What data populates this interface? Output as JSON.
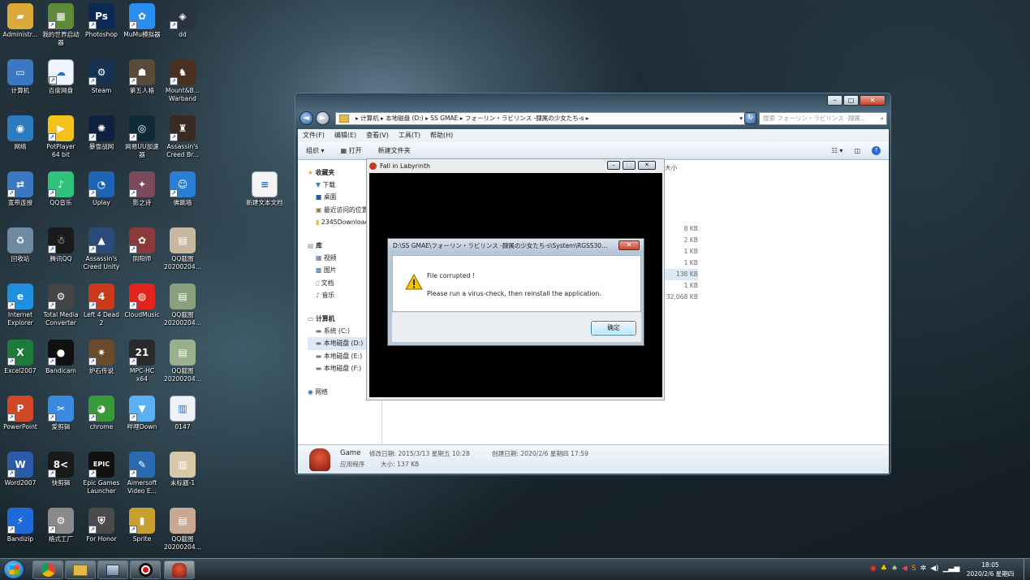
{
  "desktop": {
    "icons": [
      {
        "label": "Administr...",
        "icon": "folder-icon",
        "color": "#d9a93a",
        "glyph": "▰"
      },
      {
        "label": "我的世界启动器",
        "icon": "minecraft-icon",
        "color": "#5d8a3a",
        "glyph": "▦"
      },
      {
        "label": "Photoshop",
        "icon": "photoshop-icon",
        "color": "#0a2a55",
        "glyph": "Ps"
      },
      {
        "label": "MuMu模拟器",
        "icon": "mumu-icon",
        "color": "#2a8df0",
        "glyph": "✿"
      },
      {
        "label": "dd",
        "icon": "dd-icon",
        "color": "#2a3440",
        "glyph": "◈"
      },
      {
        "label": "计算机",
        "icon": "computer-icon",
        "color": "#3a78c2",
        "glyph": "▭"
      },
      {
        "label": "百度网盘",
        "icon": "baidu-netdisk-icon",
        "color": "#eef5ff",
        "glyph": "☁"
      },
      {
        "label": "Steam",
        "icon": "steam-icon",
        "color": "#16324f",
        "glyph": "⚙"
      },
      {
        "label": "第五人格",
        "icon": "identity-v-icon",
        "color": "#5a4a3a",
        "glyph": "☗"
      },
      {
        "label": "Mount&B... Warband",
        "icon": "mount-blade-icon",
        "color": "#4a3020",
        "glyph": "♞"
      },
      {
        "label": "网络",
        "icon": "network-icon",
        "color": "#2b7bbf",
        "glyph": "◉"
      },
      {
        "label": "PotPlayer 64 bit",
        "icon": "potplayer-icon",
        "color": "#f3c21a",
        "glyph": "▶"
      },
      {
        "label": "暴雪战网",
        "icon": "battlenet-icon",
        "color": "#0e2140",
        "glyph": "✺"
      },
      {
        "label": "网易UU加速器",
        "icon": "uu-accelerator-icon",
        "color": "#0f2b3a",
        "glyph": "◎"
      },
      {
        "label": "Assassin's Creed Br...",
        "icon": "assassins-creed-brotherhood-icon",
        "color": "#3a2a24",
        "glyph": "♜"
      },
      {
        "label": "宽带连接",
        "icon": "broadband-icon",
        "color": "#3a78c2",
        "glyph": "⇄"
      },
      {
        "label": "QQ音乐",
        "icon": "qq-music-icon",
        "color": "#31c27c",
        "glyph": "♪"
      },
      {
        "label": "Uplay",
        "icon": "uplay-icon",
        "color": "#1e64b4",
        "glyph": "◔"
      },
      {
        "label": "影之诗",
        "icon": "shadowverse-icon",
        "color": "#7a4a5a",
        "glyph": "✦"
      },
      {
        "label": "佛跳墙",
        "icon": "fotiaoqiang-icon",
        "color": "#2a7fd5",
        "glyph": "☺"
      },
      {
        "label": "回收站",
        "icon": "recycle-bin-icon",
        "color": "#6d8aa0",
        "glyph": "♻"
      },
      {
        "label": "腾讯QQ",
        "icon": "qq-icon",
        "color": "#1b1b1b",
        "glyph": "☃"
      },
      {
        "label": "Assassin's Creed Unity",
        "icon": "assassins-creed-unity-icon",
        "color": "#2a4a7a",
        "glyph": "▲"
      },
      {
        "label": "阴阳师",
        "icon": "onmyoji-icon",
        "color": "#8a3a3a",
        "glyph": "✿"
      },
      {
        "label": "QQ截图20200204...",
        "icon": "screenshot-file-icon",
        "color": "#c9b8a0",
        "glyph": "▤"
      },
      {
        "label": "Internet Explorer",
        "icon": "internet-explorer-icon",
        "color": "#1e90e0",
        "glyph": "e"
      },
      {
        "label": "Total Media Converter ...",
        "icon": "media-converter-icon",
        "color": "#444",
        "glyph": "⚙"
      },
      {
        "label": "Left 4 Dead 2",
        "icon": "left4dead2-icon",
        "color": "#c83a1a",
        "glyph": "4"
      },
      {
        "label": "CloudMusic",
        "icon": "cloudmusic-icon",
        "color": "#e2241c",
        "glyph": "◍"
      },
      {
        "label": "QQ截图20200204...",
        "icon": "screenshot-file-icon",
        "color": "#8aa07a",
        "glyph": "▤"
      },
      {
        "label": "Excel2007",
        "icon": "excel-icon",
        "color": "#1e7a3a",
        "glyph": "X"
      },
      {
        "label": "Bandicam",
        "icon": "bandicam-icon",
        "color": "#111",
        "glyph": "●"
      },
      {
        "label": "炉石传说",
        "icon": "hearthstone-icon",
        "color": "#6a4a2a",
        "glyph": "✷"
      },
      {
        "label": "MPC-HC x64",
        "icon": "mpc-hc-icon",
        "color": "#2a2a2a",
        "glyph": "21"
      },
      {
        "label": "QQ截图20200204...",
        "icon": "screenshot-file-icon",
        "color": "#9ab08a",
        "glyph": "▤"
      },
      {
        "label": "PowerPoint",
        "icon": "powerpoint-icon",
        "color": "#d24726",
        "glyph": "P"
      },
      {
        "label": "爱剪辑",
        "icon": "aijianji-icon",
        "color": "#3a8ae0",
        "glyph": "✂"
      },
      {
        "label": "chrome",
        "icon": "chrome-icon",
        "color": "#3a9a3a",
        "glyph": "◕"
      },
      {
        "label": "哔哩Down",
        "icon": "bilidown-icon",
        "color": "#5ab0f0",
        "glyph": "▼"
      },
      {
        "label": "0147",
        "icon": "image-file-icon",
        "color": "#eef2f6",
        "glyph": "▥"
      },
      {
        "label": "Word2007",
        "icon": "word-icon",
        "color": "#2a5aa8",
        "glyph": "W"
      },
      {
        "label": "快剪辑",
        "icon": "kuaijianji-icon",
        "color": "#1a1a1a",
        "glyph": "8<"
      },
      {
        "label": "Epic Games Launcher",
        "icon": "epic-games-icon",
        "color": "#111",
        "glyph": "EPIC"
      },
      {
        "label": "Aimersoft Video E...",
        "icon": "aimersoft-icon",
        "color": "#2a6ab0",
        "glyph": "✎"
      },
      {
        "label": "未标题-1",
        "icon": "image-file-icon",
        "color": "#d8c8a8",
        "glyph": "▥"
      },
      {
        "label": "Bandizip",
        "icon": "bandizip-icon",
        "color": "#1e6ad8",
        "glyph": "⚡"
      },
      {
        "label": "格式工厂",
        "icon": "format-factory-icon",
        "color": "#8a8a8a",
        "glyph": "⚙"
      },
      {
        "label": "For Honor",
        "icon": "for-honor-icon",
        "color": "#4a4a4a",
        "glyph": "⛨"
      },
      {
        "label": "Sprite",
        "icon": "sprite-icon",
        "color": "#c8a030",
        "glyph": "▮"
      },
      {
        "label": "QQ截图20200204...",
        "icon": "screenshot-file-icon",
        "color": "#c8a890",
        "glyph": "▤"
      },
      {
        "label": "新建文本文档",
        "icon": "text-document-icon",
        "color": "#f4f4f4",
        "glyph": "≡"
      }
    ]
  },
  "explorer": {
    "breadcrumb": "▸ 计算机 ▸ 本地磁盘 (D:) ▸ SS GMAE ▸ フォーリン・ラビリンス -隷属の少女たち-s ▸",
    "search_placeholder": "搜索 フォーリン・ラビリンス -隷属...",
    "menu": {
      "file": "文件(F)",
      "edit": "编辑(E)",
      "view": "查看(V)",
      "tools": "工具(T)",
      "help": "帮助(H)"
    },
    "toolbar": {
      "organize": "组织 ▾",
      "open": "打开",
      "new_folder": "新建文件夹"
    },
    "sidebar": {
      "favorites": "收藏夹",
      "downloads": "下载",
      "desktop": "桌面",
      "recent": "最近访问的位置",
      "downloads2345": "2345Downloads",
      "libraries": "库",
      "videos": "视频",
      "pictures": "图片",
      "documents": "文档",
      "music": "音乐",
      "computer": "计算机",
      "drive_c": "系统 (C:)",
      "drive_d": "本地磁盘 (D:)",
      "drive_e": "本地磁盘 (E:)",
      "drive_f": "本地磁盘 (F:)",
      "network": "网络"
    },
    "size_header": "大小",
    "sizes": [
      "8 KB",
      "2 KB",
      "1 KB",
      "1 KB",
      "138 KB",
      "1 KB",
      "32,068 KB"
    ],
    "details": {
      "name": "Game",
      "modified": "修改日期: 2015/3/13 星期五 10:28",
      "created": "创建日期: 2020/2/6 星期四 17:59",
      "type": "应用程序",
      "size": "大小: 137 KB"
    }
  },
  "game_window": {
    "title": "Fall in Labyrinth"
  },
  "error_dialog": {
    "title": "D:\\SS GMAE\\フォーリン・ラビリンス -隷属の少女たち-s\\System\\RGSS30...",
    "line1": "File corrupted !",
    "line2": "Please run a virus-check, then reinstall the application.",
    "ok_label": "确定"
  },
  "taskbar": {
    "time": "18:05",
    "date": "2020/2/6 星期四"
  }
}
